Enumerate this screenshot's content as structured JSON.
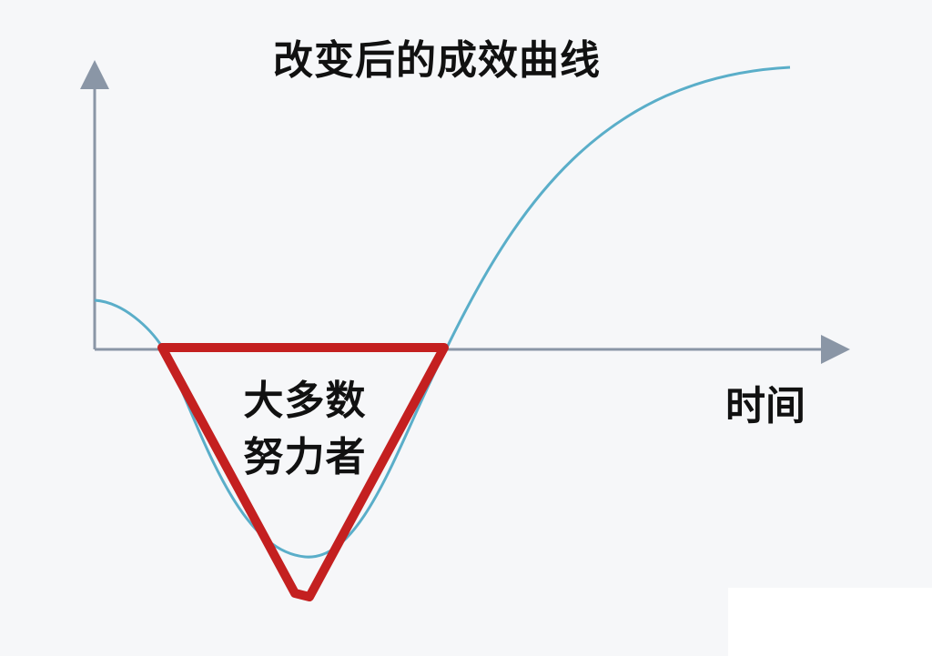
{
  "diagram": {
    "title": "改变后的成效曲线",
    "x_axis_label": "时间",
    "annotation_lines": [
      "大多数",
      "努力者"
    ],
    "colors": {
      "background": "#f6f7f9",
      "curve": "#5aaec9",
      "axis": "#8a96a6",
      "triangle": "#c42020",
      "text": "#111111"
    }
  }
}
